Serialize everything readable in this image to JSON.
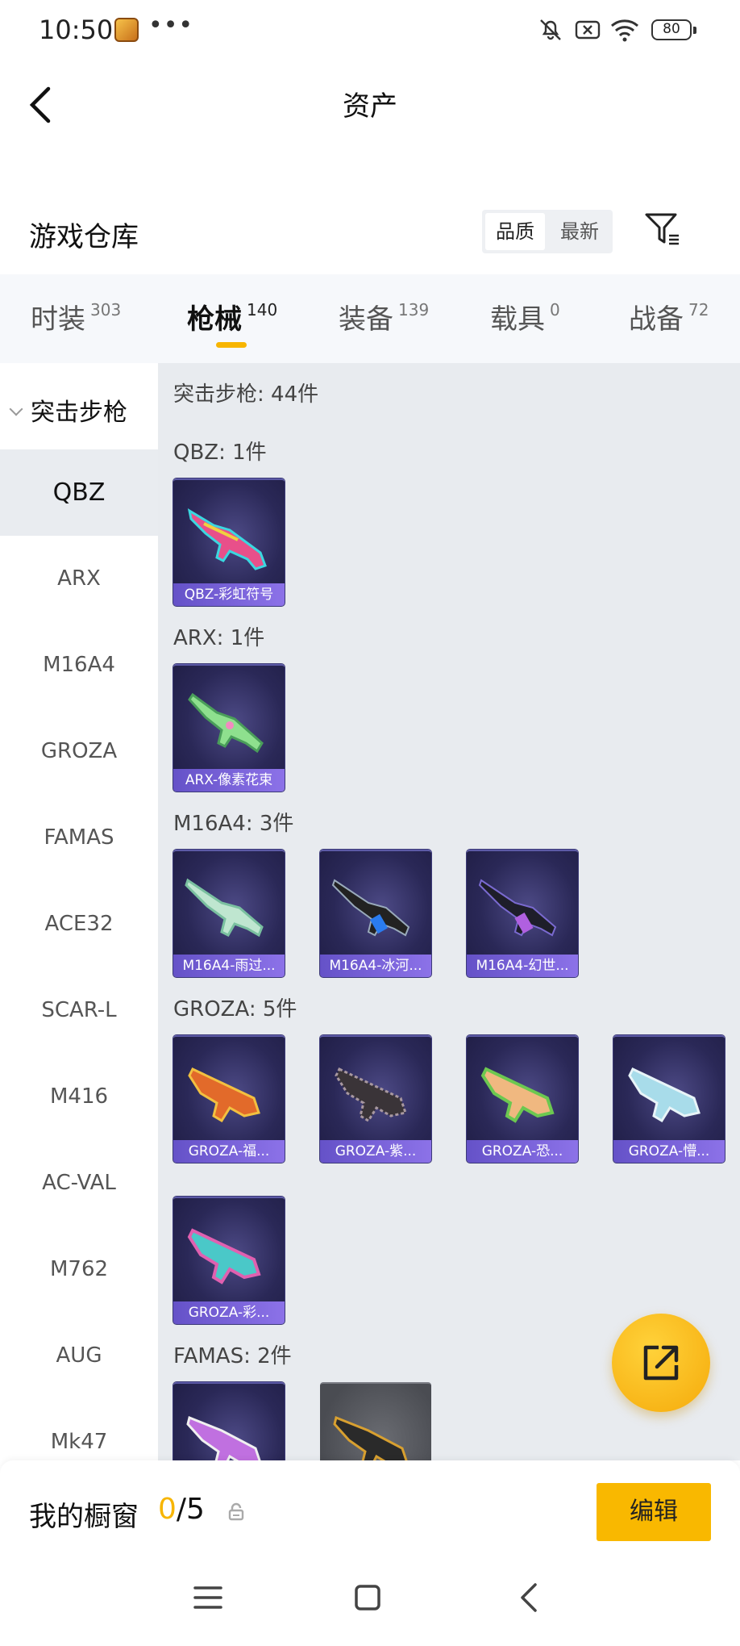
{
  "status_bar": {
    "time": "10:50",
    "dots": "•••",
    "battery": "80"
  },
  "header": {
    "title": "资产"
  },
  "warehouse": {
    "title": "游戏仓库",
    "sort_quality": "品质",
    "sort_newest": "最新"
  },
  "tabs": [
    {
      "label": "时装",
      "count": "303"
    },
    {
      "label": "枪械",
      "count": "140"
    },
    {
      "label": "装备",
      "count": "139"
    },
    {
      "label": "载具",
      "count": "0"
    },
    {
      "label": "战备",
      "count": "72"
    }
  ],
  "sidebar": {
    "category": "突击步枪",
    "items": [
      "QBZ",
      "ARX",
      "M16A4",
      "GROZA",
      "FAMAS",
      "ACE32",
      "SCAR-L",
      "M416",
      "AC-VAL",
      "M762",
      "AUG",
      "Mk47"
    ]
  },
  "content": {
    "category_total": "突击步枪: 44件",
    "groups": [
      {
        "title": "QBZ: 1件",
        "items": [
          "QBZ-彩虹符号"
        ]
      },
      {
        "title": "ARX: 1件",
        "items": [
          "ARX-像素花束"
        ]
      },
      {
        "title": "M16A4: 3件",
        "items": [
          "M16A4-雨过...",
          "M16A4-冰河...",
          "M16A4-幻世..."
        ]
      },
      {
        "title": "GROZA: 5件",
        "items": [
          "GROZA-福...",
          "GROZA-紫...",
          "GROZA-恐...",
          "GROZA-懵...",
          "GROZA-彩..."
        ]
      },
      {
        "title": "FAMAS: 2件",
        "items": [
          "",
          ""
        ]
      }
    ]
  },
  "showcase": {
    "label": "我的橱窗",
    "count_used": "0",
    "count_total": "/5",
    "edit_label": "编辑"
  },
  "colors": {
    "accent": "#f7b500",
    "card_bg": "#2a2857",
    "card_label": "#7a62d8"
  },
  "icons": [
    "back-arrow-icon",
    "filter-icon",
    "share-icon",
    "lock-icon",
    "menu-icon",
    "home-icon",
    "nav-back-icon"
  ]
}
